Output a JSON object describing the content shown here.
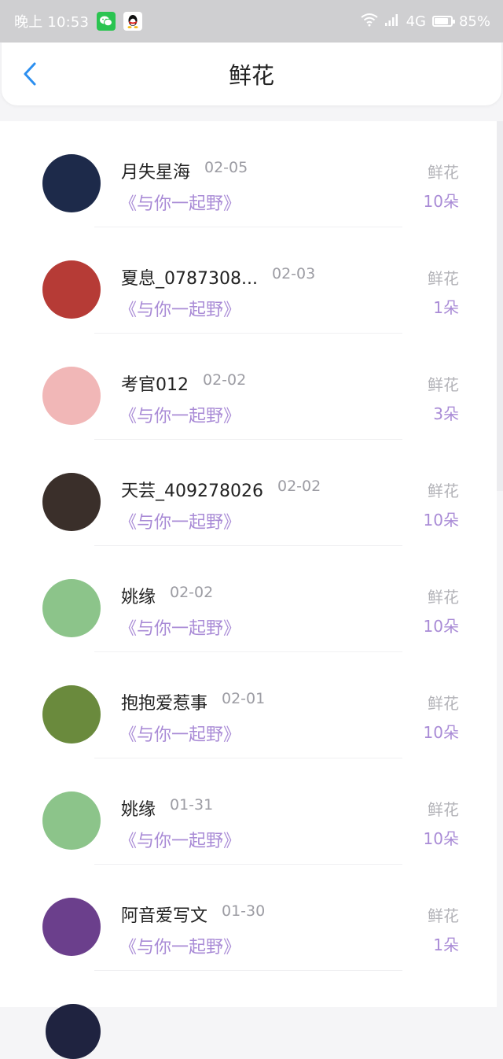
{
  "status_bar": {
    "time": "晚上 10:53",
    "network": "4G",
    "battery": "85%",
    "battery_level": 0.85
  },
  "nav": {
    "title": "鲜花"
  },
  "rows": [
    {
      "name": "月失星海",
      "date": "02-05",
      "book": "《与你一起野》",
      "gift": "鲜花",
      "count": "10朵",
      "avatar_color": "#1d2a4a"
    },
    {
      "name": "夏息_0787308...",
      "date": "02-03",
      "book": "《与你一起野》",
      "gift": "鲜花",
      "count": "1朵",
      "avatar_color": "#b63b36"
    },
    {
      "name": "考官012",
      "date": "02-02",
      "book": "《与你一起野》",
      "gift": "鲜花",
      "count": "3朵",
      "avatar_color": "#f1b7b7"
    },
    {
      "name": "天芸_409278026",
      "date": "02-02",
      "book": "《与你一起野》",
      "gift": "鲜花",
      "count": "10朵",
      "avatar_color": "#3a2f2a"
    },
    {
      "name": "姚缘",
      "date": "02-02",
      "book": "《与你一起野》",
      "gift": "鲜花",
      "count": "10朵",
      "avatar_color": "#8cc48a"
    },
    {
      "name": "抱抱爱惹事",
      "date": "02-01",
      "book": "《与你一起野》",
      "gift": "鲜花",
      "count": "10朵",
      "avatar_color": "#6a8a3d"
    },
    {
      "name": "姚缘",
      "date": "01-31",
      "book": "《与你一起野》",
      "gift": "鲜花",
      "count": "10朵",
      "avatar_color": "#8cc48a"
    },
    {
      "name": "阿音爱写文",
      "date": "01-30",
      "book": "《与你一起野》",
      "gift": "鲜花",
      "count": "1朵",
      "avatar_color": "#6b3f8c"
    }
  ]
}
